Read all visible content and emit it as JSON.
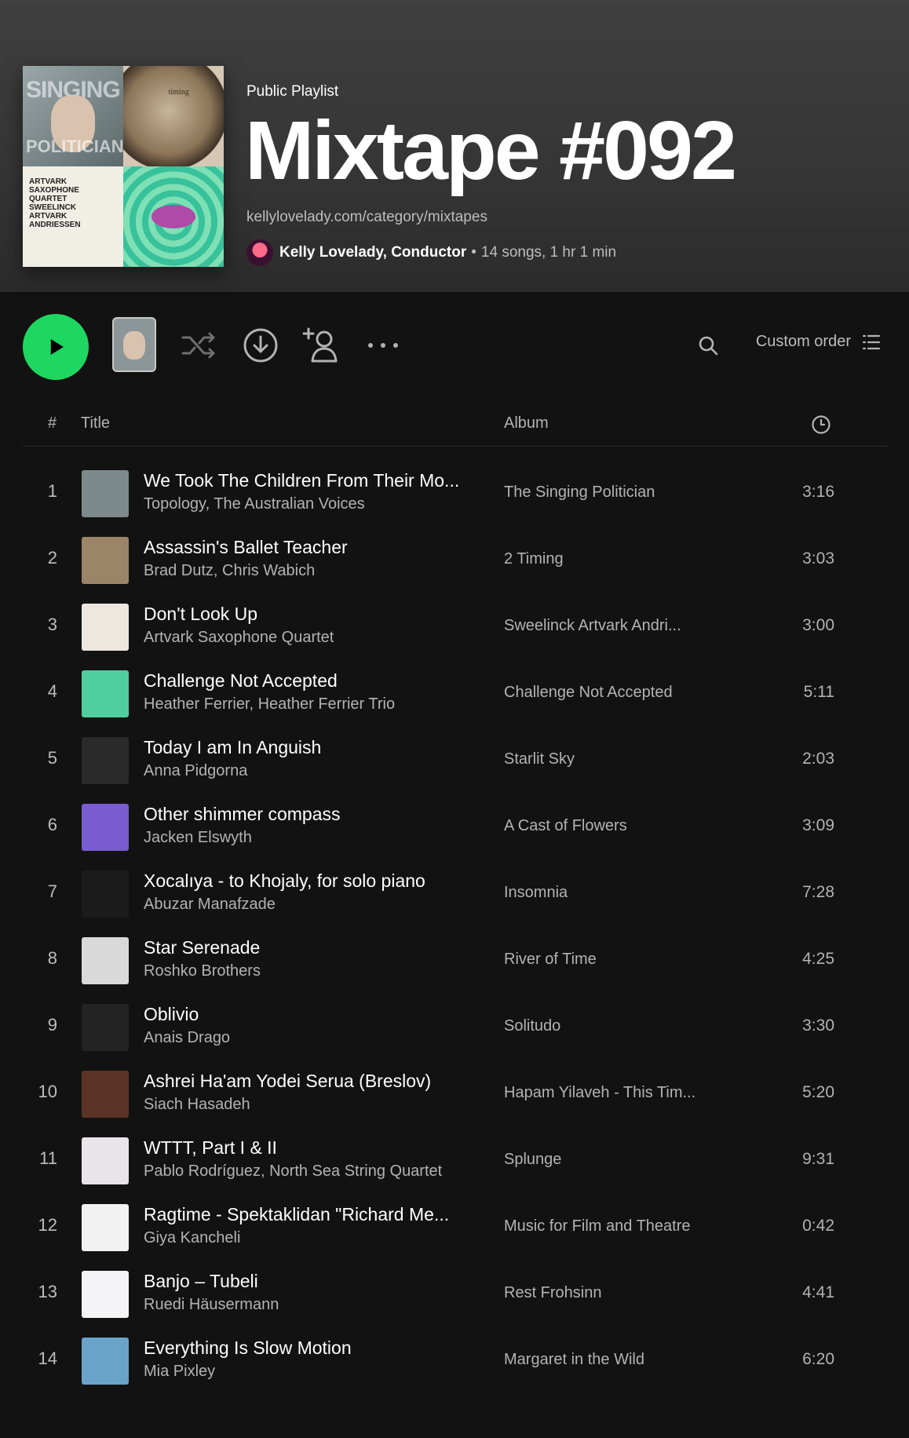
{
  "playlist": {
    "type": "Public Playlist",
    "title": "Mixtape #092",
    "description": "kellylovelady.com/category/mixtapes",
    "owner": "Kelly Lovelady, Conductor",
    "separator": "•",
    "stats": "14 songs, 1 hr 1 min",
    "cover_text_1": "SINGING",
    "cover_text_2": "POLITICIAN",
    "cover_text_3": "ARTVARK SAXOPHONE QUARTET SWEELINCK ARTVARK ANDRIESSEN",
    "cover_text_4": "timing"
  },
  "controls": {
    "sort_label": "Custom order"
  },
  "columns": {
    "number": "#",
    "title": "Title",
    "album": "Album"
  },
  "colors": {
    "accent": "#1ed760",
    "background": "#121212",
    "header_top": "#3f3f3f"
  },
  "tracks": [
    {
      "n": "1",
      "title": "We Took The Children From Their Mo...",
      "artist": "Topology, The Australian Voices",
      "album": "The Singing Politician",
      "duration": "3:16",
      "art": "#7d8a8c"
    },
    {
      "n": "2",
      "title": "Assassin's Ballet Teacher",
      "artist": "Brad Dutz, Chris Wabich",
      "album": "2 Timing",
      "duration": "3:03",
      "art": "#9c8468"
    },
    {
      "n": "3",
      "title": "Don't Look Up",
      "artist": "Artvark Saxophone Quartet",
      "album": "Sweelinck Artvark Andri...",
      "duration": "3:00",
      "art": "#ece8df"
    },
    {
      "n": "4",
      "title": "Challenge Not Accepted",
      "artist": "Heather Ferrier, Heather Ferrier Trio",
      "album": "Challenge Not Accepted",
      "duration": "5:11",
      "art": "#4fcf9f"
    },
    {
      "n": "5",
      "title": "Today I am In Anguish",
      "artist": "Anna Pidgorna",
      "album": "Starlit Sky",
      "duration": "2:03",
      "art": "#2a2a2a"
    },
    {
      "n": "6",
      "title": "Other shimmer compass",
      "artist": "Jacken Elswyth",
      "album": "A Cast of Flowers",
      "duration": "3:09",
      "art": "#7a5bd0"
    },
    {
      "n": "7",
      "title": "Xocalıya - to Khojaly, for solo piano",
      "artist": "Abuzar Manafzade",
      "album": "Insomnia",
      "duration": "7:28",
      "art": "#1b1b1b"
    },
    {
      "n": "8",
      "title": "Star Serenade",
      "artist": "Roshko Brothers",
      "album": "River of Time",
      "duration": "4:25",
      "art": "#d9d9d9"
    },
    {
      "n": "9",
      "title": "Oblivio",
      "artist": "Anais Drago",
      "album": "Solitudo",
      "duration": "3:30",
      "art": "#232323"
    },
    {
      "n": "10",
      "title": "Ashrei Ha'am Yodei Serua (Breslov)",
      "artist": "Siach Hasadeh",
      "album": "Hapam Yilaveh - This Tim...",
      "duration": "5:20",
      "art": "#5a3326"
    },
    {
      "n": "11",
      "title": "WTTT, Part I & II",
      "artist": "Pablo Rodríguez, North Sea String Quartet",
      "album": "Splunge",
      "duration": "9:31",
      "art": "#e8e4ea"
    },
    {
      "n": "12",
      "title": "Ragtime - Spektaklidan \"Richard Me...",
      "artist": "Giya Kancheli",
      "album": "Music for Film and Theatre",
      "duration": "0:42",
      "art": "#f2f2f2"
    },
    {
      "n": "13",
      "title": "Banjo – Tubeli",
      "artist": "Ruedi Häusermann",
      "album": "Rest Frohsinn",
      "duration": "4:41",
      "art": "#f4f4f6"
    },
    {
      "n": "14",
      "title": "Everything Is Slow Motion",
      "artist": "Mia Pixley",
      "album": "Margaret in the Wild",
      "duration": "6:20",
      "art": "#6aa3c9"
    }
  ]
}
